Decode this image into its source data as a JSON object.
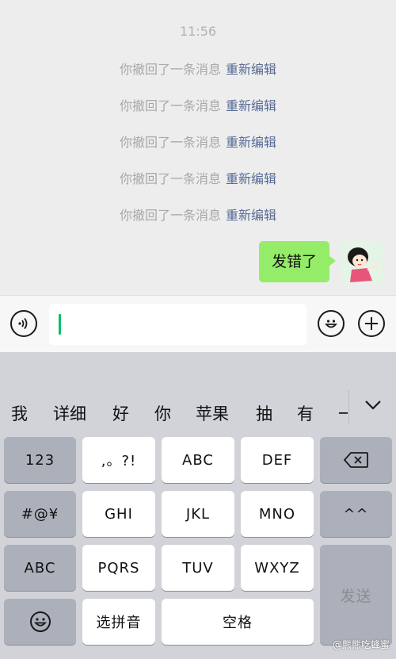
{
  "chat": {
    "time": "11:56",
    "recall_notices": [
      {
        "text": "你撤回了一条消息",
        "action": "重新编辑"
      },
      {
        "text": "你撤回了一条消息",
        "action": "重新编辑"
      },
      {
        "text": "你撤回了一条消息",
        "action": "重新编辑"
      },
      {
        "text": "你撤回了一条消息",
        "action": "重新编辑"
      },
      {
        "text": "你撤回了一条消息",
        "action": "重新编辑"
      }
    ],
    "sent_message": "发错了"
  },
  "input_bar": {
    "voice_icon": "voice-icon",
    "emoji_icon": "emoji-icon",
    "plus_icon": "plus-icon",
    "value": ""
  },
  "keyboard": {
    "candidates": [
      "我",
      "详细",
      "好",
      "你",
      "苹果",
      "抽",
      "有",
      "一"
    ],
    "keys": {
      "num": "123",
      "punct": ",。?!",
      "abc1": "ABC",
      "def": "DEF",
      "symbols": "#@¥",
      "ghi": "GHI",
      "jkl": "JKL",
      "mno": "MNO",
      "emoticon": "^^",
      "abc_switch": "ABC",
      "pqrs": "PQRS",
      "tuv": "TUV",
      "wxyz": "WXYZ",
      "send": "发送",
      "pinyin": "选拼音",
      "space": "空格"
    }
  },
  "watermark": "@熊熊吃蜂蜜",
  "colors": {
    "chat_bg": "#ededed",
    "bubble": "#95ec69",
    "link": "#576b95",
    "caret": "#07c160",
    "keyboard_bg": "#d1d3d9"
  }
}
